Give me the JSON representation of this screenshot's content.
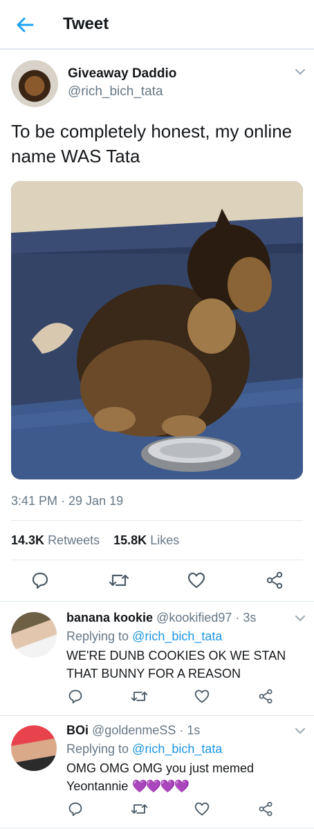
{
  "header": {
    "title": "Tweet"
  },
  "tweet": {
    "author_name": "Giveaway Daddio",
    "author_handle": "@rich_bich_tata",
    "text": "To be completely honest, my online name WAS Tata",
    "time": "3:41 PM · 29 Jan 19",
    "retweets_count": "14.3K",
    "retweets_label": "Retweets",
    "likes_count": "15.8K",
    "likes_label": "Likes"
  },
  "replies": [
    {
      "name": "banana kookie",
      "handle_time": "@kookified97 · 3s",
      "replying_prefix": "Replying to",
      "replying_handle": "@rich_bich_tata",
      "text": "WE'RE DUNB COOKIES OK WE STAN THAT BUNNY FOR A REASON"
    },
    {
      "name": "BOi",
      "handle_time": "@goldenmeSS · 1s",
      "replying_prefix": "Replying to",
      "replying_handle": "@rich_bich_tata",
      "text": "OMG OMG OMG you just memed Yeontannie",
      "emoji": "💜💜💜💜"
    }
  ],
  "colors": {
    "accent": "#1b95e0",
    "secondary_text": "#657786",
    "divider": "#e1e8ed",
    "emoji_heart": "#a024e0"
  },
  "icons": [
    "back-arrow-icon",
    "chevron-down-icon",
    "reply-icon",
    "retweet-icon",
    "like-icon",
    "share-icon"
  ]
}
